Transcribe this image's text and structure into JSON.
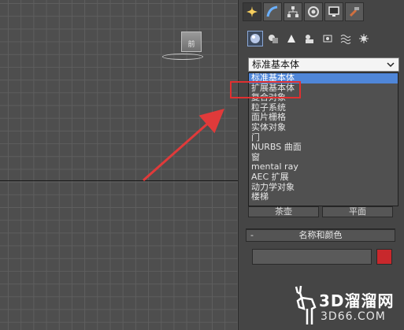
{
  "viewport": {
    "viewcube_label": "前"
  },
  "panel": {
    "tabs": [
      {
        "icon": "create-icon",
        "active": true
      },
      {
        "icon": "modify-icon",
        "active": false
      },
      {
        "icon": "hierarchy-icon",
        "active": false
      },
      {
        "icon": "motion-icon",
        "active": false
      },
      {
        "icon": "display-icon",
        "active": false
      },
      {
        "icon": "utilities-icon",
        "active": false
      }
    ],
    "subcategories": [
      {
        "icon": "geometry-icon",
        "active": true
      },
      {
        "icon": "shapes-icon",
        "active": false
      },
      {
        "icon": "lights-icon",
        "active": false
      },
      {
        "icon": "cameras-icon",
        "active": false
      },
      {
        "icon": "helpers-icon",
        "active": false
      },
      {
        "icon": "space-warps-icon",
        "active": false
      },
      {
        "icon": "systems-icon",
        "active": false
      }
    ],
    "combo_value": "标准基本体",
    "dropdown_items": [
      "标准基本体",
      "扩展基本体",
      "复合对象",
      "粒子系统",
      "面片栅格",
      "实体对象",
      "门",
      "NURBS 曲面",
      "窗",
      "mental ray",
      "AEC 扩展",
      "动力学对象",
      "楼梯"
    ],
    "selected_item": "标准基本体",
    "highlighted_item": "扩展基本体",
    "buttons": [
      "茶壶",
      "平面"
    ],
    "rollout_minus": "-",
    "rollout_title": "名称和颜色",
    "color_swatch": "#c8282c"
  },
  "watermark": {
    "text": "3D溜溜网",
    "subtext": "3D66.COM"
  },
  "colors": {
    "highlight": "#e03030",
    "selection": "#4f86d8",
    "arrow": "#e03a3a"
  }
}
